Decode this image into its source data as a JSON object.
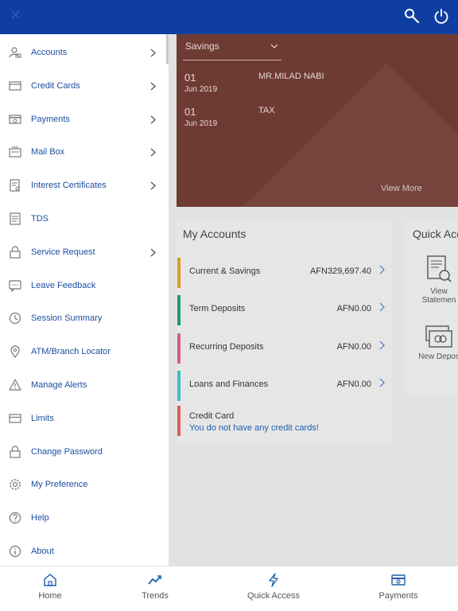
{
  "header": {
    "close_icon": "close-icon",
    "search_icon": "search-icon",
    "power_icon": "power-icon"
  },
  "drawer": {
    "items": [
      {
        "label": "Accounts",
        "icon": "accounts-icon",
        "chevron": true
      },
      {
        "label": "Credit Cards",
        "icon": "credit-card-icon",
        "chevron": true
      },
      {
        "label": "Payments",
        "icon": "payments-icon",
        "chevron": true
      },
      {
        "label": "Mail Box",
        "icon": "mailbox-icon",
        "chevron": true
      },
      {
        "label": "Interest Certificates",
        "icon": "certificate-icon",
        "chevron": true
      },
      {
        "label": "TDS",
        "icon": "tds-icon",
        "chevron": false
      },
      {
        "label": "Service Request",
        "icon": "lock-icon",
        "chevron": true
      },
      {
        "label": "Leave Feedback",
        "icon": "feedback-icon",
        "chevron": false
      },
      {
        "label": "Session Summary",
        "icon": "clock-icon",
        "chevron": false
      },
      {
        "label": "ATM/Branch Locator",
        "icon": "location-pin-icon",
        "chevron": false
      },
      {
        "label": "Manage Alerts",
        "icon": "alert-icon",
        "chevron": false
      },
      {
        "label": "Limits",
        "icon": "limits-icon",
        "chevron": false
      },
      {
        "label": "Change Password",
        "icon": "lock-icon",
        "chevron": false
      },
      {
        "label": "My Preference",
        "icon": "gear-icon",
        "chevron": false
      },
      {
        "label": "Help",
        "icon": "help-icon",
        "chevron": false
      },
      {
        "label": "About",
        "icon": "info-icon",
        "chevron": false
      }
    ]
  },
  "hero": {
    "select_value": "Savings",
    "transactions": [
      {
        "day": "01",
        "month_year": "Jun 2019",
        "description": "MR.MILAD NABI"
      },
      {
        "day": "01",
        "month_year": "Jun 2019",
        "description": "TAX"
      }
    ],
    "view_more": "View More"
  },
  "my_accounts": {
    "title": "My Accounts",
    "rows": [
      {
        "name": "Current & Savings",
        "amount": "AFN329,697.40",
        "color": "#d8a01e"
      },
      {
        "name": "Term Deposits",
        "amount": "AFN0.00",
        "color": "#1e9a6e"
      },
      {
        "name": "Recurring Deposits",
        "amount": "AFN0.00",
        "color": "#d85a8a"
      },
      {
        "name": "Loans and Finances",
        "amount": "AFN0.00",
        "color": "#3bbfc7"
      }
    ],
    "credit_card": {
      "name": "Credit Card",
      "message": "You do not have any credit cards!",
      "color": "#e05a5a"
    }
  },
  "quick_access": {
    "title": "Quick Acc",
    "items": [
      {
        "label_line1": "View",
        "label_line2": "Statemen",
        "icon": "view-statement-icon"
      },
      {
        "label_line1": "New Depos",
        "label_line2": "",
        "icon": "new-deposit-icon"
      }
    ]
  },
  "bottom_nav": {
    "items": [
      {
        "label": "Home",
        "icon": "home-icon"
      },
      {
        "label": "Trends",
        "icon": "trends-icon"
      },
      {
        "label": "Quick Access",
        "icon": "lightning-icon"
      },
      {
        "label": "Payments",
        "icon": "payments-icon"
      }
    ]
  },
  "colors": {
    "header_bg": "#0e3fa0",
    "menu_text": "#1e4fa0",
    "hero_bg": "#6e3b33",
    "link": "#1e5fae"
  }
}
